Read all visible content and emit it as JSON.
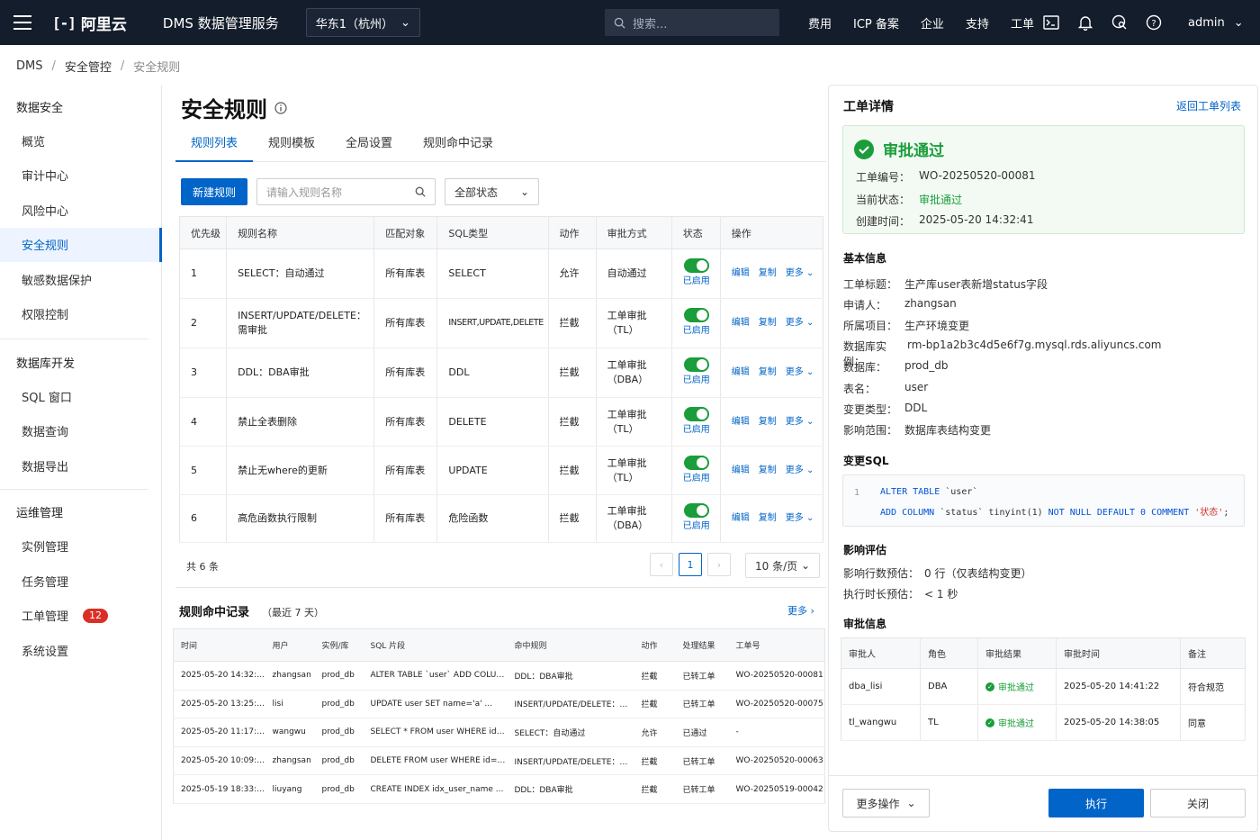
{
  "topbar": {
    "brand": "阿里云",
    "product": "DMS 数据管理服务",
    "region": "华东1（杭州）",
    "search_placeholder": "搜索...",
    "nav": [
      "费用",
      "ICP 备案",
      "企业",
      "支持",
      "工单"
    ],
    "user": "admin"
  },
  "breadcrumb": [
    "DMS",
    "安全管控",
    "安全规则"
  ],
  "sidebar": {
    "sections": [
      {
        "title": "数据安全",
        "items": [
          "概览",
          "审计中心",
          "风险中心",
          "安全规则",
          "敏感数据保护",
          "权限控制"
        ]
      },
      {
        "title": "数据库开发",
        "items": [
          "SQL 窗口",
          "数据查询",
          "数据导出"
        ]
      },
      {
        "title": "运维管理",
        "items": [
          "实例管理",
          "任务管理",
          "工单管理",
          "系统设置"
        ]
      }
    ],
    "active": "安全规则",
    "badge": "12"
  },
  "main": {
    "title": "安全规则",
    "tabs": [
      "规则列表",
      "规则模板",
      "全局设置",
      "规则命中记录"
    ],
    "new_btn": "新建规则",
    "search_placeholder": "请输入规则名称",
    "status_filter": "全部状态",
    "columns": [
      "优先级",
      "规则名称",
      "匹配对象",
      "SQL类型",
      "动作",
      "审批方式",
      "状态",
      "操作"
    ],
    "rows": [
      {
        "p": "1",
        "name": "SELECT：自动通过",
        "obj": "所有库表",
        "sql": "SELECT",
        "act": "允许",
        "appr": "自动通过",
        "status": "已启用"
      },
      {
        "p": "2",
        "name": "INSERT/UPDATE/DELETE：需审批",
        "obj": "所有库表",
        "sql": "INSERT,UPDATE,DELETE",
        "act": "拦截",
        "appr": "工单审批（TL）",
        "status": "已启用"
      },
      {
        "p": "3",
        "name": "DDL：DBA审批",
        "obj": "所有库表",
        "sql": "DDL",
        "act": "拦截",
        "appr": "工单审批（DBA）",
        "status": "已启用"
      },
      {
        "p": "4",
        "name": "禁止全表删除",
        "obj": "所有库表",
        "sql": "DELETE",
        "act": "拦截",
        "appr": "工单审批（TL）",
        "status": "已启用"
      },
      {
        "p": "5",
        "name": "禁止无where的更新",
        "obj": "所有库表",
        "sql": "UPDATE",
        "act": "拦截",
        "appr": "工单审批（TL）",
        "status": "已启用"
      },
      {
        "p": "6",
        "name": "高危函数执行限制",
        "obj": "所有库表",
        "sql": "危险函数",
        "act": "拦截",
        "appr": "工单审批（DBA）",
        "status": "已启用"
      }
    ],
    "ops": [
      "编辑",
      "复制",
      "更多"
    ],
    "total": "共 6 条",
    "page": "1",
    "page_size": "10 条/页",
    "hits_title": "规则命中记录",
    "hits_sub": "（最近 7 天）",
    "hits_more": "更多",
    "hit_columns": [
      "时间",
      "用户",
      "实例/库",
      "SQL 片段",
      "命中规则",
      "动作",
      "处理结果",
      "工单号"
    ],
    "hits": [
      [
        "2025-05-20 14:32:18",
        "zhangsan",
        "prod_db",
        "ALTER TABLE `user` ADD COLUMN ...",
        "DDL：DBA审批",
        "拦截",
        "已转工单",
        "WO-20250520-00081"
      ],
      [
        "2025-05-20 13:25:47",
        "lisi",
        "prod_db",
        "UPDATE user SET name='a' ...",
        "INSERT/UPDATE/DELETE：需...",
        "拦截",
        "已转工单",
        "WO-20250520-00075"
      ],
      [
        "2025-05-20 11:17:03",
        "wangwu",
        "prod_db",
        "SELECT * FROM user WHERE id=1",
        "SELECT：自动通过",
        "允许",
        "已通过",
        "-"
      ],
      [
        "2025-05-20 10:09:21",
        "zhangsan",
        "prod_db",
        "DELETE FROM user WHERE id=10",
        "INSERT/UPDATE/DELETE：需...",
        "拦截",
        "已转工单",
        "WO-20250520-00063"
      ],
      [
        "2025-05-19 18:33:02",
        "liuyang",
        "prod_db",
        "CREATE INDEX idx_user_name ...",
        "DDL：DBA审批",
        "拦截",
        "已转工单",
        "WO-20250519-00042"
      ]
    ]
  },
  "panel": {
    "title": "工单详情",
    "back": "返回工单列表",
    "status_title": "审批通过",
    "summary": [
      [
        "工单编号：",
        "WO-20250520-00081"
      ],
      [
        "当前状态：",
        "审批通过"
      ],
      [
        "创建时间：",
        "2025-05-20 14:32:41"
      ]
    ],
    "basic_title": "基本信息",
    "basic": [
      [
        "工单标题：",
        "生产库user表新增status字段"
      ],
      [
        "申请人：",
        "zhangsan"
      ],
      [
        "所属项目：",
        "生产环境变更"
      ],
      [
        "数据库实例：",
        "rm-bp1a2b3c4d5e6f7g.mysql.rds.aliyuncs.com"
      ],
      [
        "数据库：",
        "prod_db"
      ],
      [
        "表名：",
        "user"
      ],
      [
        "变更类型：",
        "DDL"
      ],
      [
        "影响范围：",
        "数据库表结构变更"
      ]
    ],
    "sql_title": "变更SQL",
    "sql_line_no": "1",
    "impact_title": "影响评估",
    "impact": [
      [
        "影响行数预估：",
        "0 行（仅表结构变更）"
      ],
      [
        "执行时长预估：",
        "< 1 秒"
      ]
    ],
    "approval_title": "审批信息",
    "approval_columns": [
      "审批人",
      "角色",
      "审批结果",
      "审批时间",
      "备注"
    ],
    "approvals": [
      [
        "dba_lisi",
        "DBA",
        "审批通过",
        "2025-05-20 14:41:22",
        "符合规范"
      ],
      [
        "tl_wangwu",
        "TL",
        "审批通过",
        "2025-05-20 14:38:05",
        "同意"
      ]
    ],
    "more_ops": "更多操作",
    "execute": "执行",
    "close": "关闭"
  }
}
